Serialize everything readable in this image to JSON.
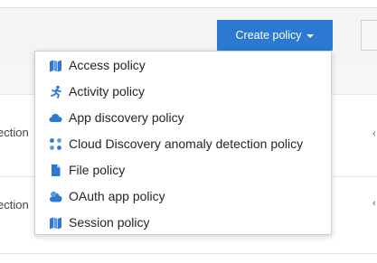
{
  "toolbar": {
    "create_label": "Create policy"
  },
  "background_rows": {
    "row1_text": "ection",
    "row2_text": "ection",
    "right_mark": "‹"
  },
  "menu": {
    "items": [
      {
        "label": "Access policy",
        "icon": "access-policy-icon"
      },
      {
        "label": "Activity policy",
        "icon": "activity-policy-icon"
      },
      {
        "label": "App discovery policy",
        "icon": "cloud-icon"
      },
      {
        "label": "Cloud Discovery anomaly detection policy",
        "icon": "anomaly-dots-icon"
      },
      {
        "label": "File policy",
        "icon": "file-icon"
      },
      {
        "label": "OAuth app policy",
        "icon": "oauth-app-icon"
      },
      {
        "label": "Session policy",
        "icon": "session-policy-icon"
      }
    ]
  },
  "colors": {
    "accent": "#2b79d2",
    "icon": "#2b79d2"
  }
}
